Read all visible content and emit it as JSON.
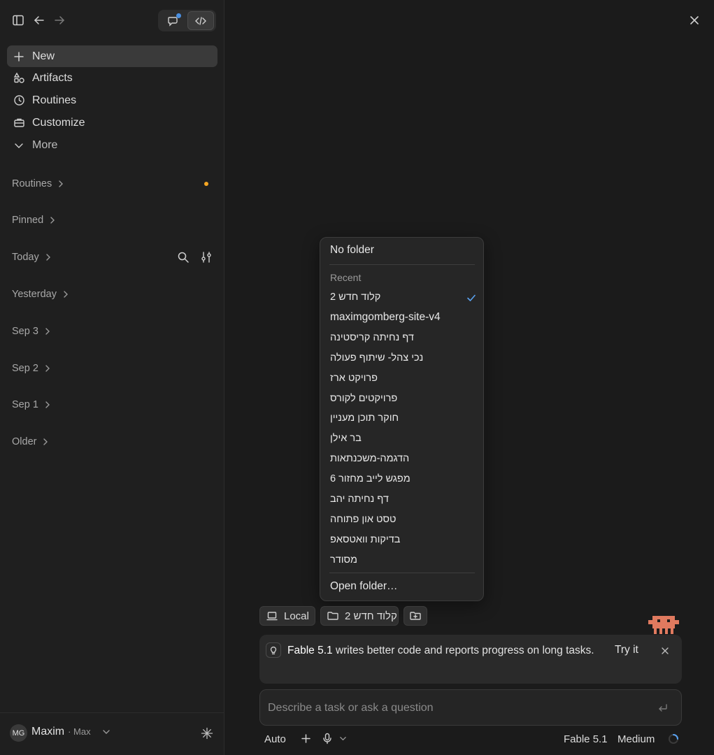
{
  "sidebar": {
    "nav": [
      {
        "label": "New",
        "icon": "plus-icon"
      },
      {
        "label": "Artifacts",
        "icon": "shapes-icon"
      },
      {
        "label": "Routines",
        "icon": "clock-icon"
      },
      {
        "label": "Customize",
        "icon": "briefcase-icon"
      },
      {
        "label": "More",
        "icon": "chevron-down-icon"
      }
    ],
    "sections": [
      {
        "label": "Routines"
      },
      {
        "label": "Pinned"
      },
      {
        "label": "Today"
      },
      {
        "label": "Yesterday"
      },
      {
        "label": "Sep 3"
      },
      {
        "label": "Sep 2"
      },
      {
        "label": "Sep 1"
      },
      {
        "label": "Older"
      }
    ],
    "notification_dot_color": "#f5a623",
    "user": {
      "initials": "MG",
      "name": "Maxim",
      "plan": "· Max"
    }
  },
  "folder_menu": {
    "no_folder": "No folder",
    "recent_label": "Recent",
    "recent": [
      "קלוד חדש 2",
      "maximgomberg-site-v4",
      "דף נחיתה קריסטינה",
      "נכי צהל- שיתוף פעולה",
      "פרויקט ארז",
      "פרויקטים לקורס",
      "חוקר תוכן מעניין",
      "בר אילן",
      "הדגמה-משכנתאות",
      "מפגש לייב מחזור 6",
      "דף נחיתה יהב",
      "טסט און פתוחה",
      "בדיקות וואטסאפ",
      "מסודר"
    ],
    "selected_index": 0,
    "open_folder": "Open folder…"
  },
  "chips": {
    "local": "Local",
    "folder": "קלוד חדש 2"
  },
  "banner": {
    "model": "Fable 5.1",
    "text": "writes better code and reports progress on long tasks.",
    "try_label": "Try it"
  },
  "composer": {
    "placeholder": "Describe a task or ask a question"
  },
  "bottom": {
    "mode": "Auto",
    "model": "Fable 5.1",
    "effort": "Medium"
  },
  "colors": {
    "accent_blue": "#5aa2f0",
    "mascot": "#e07a5f"
  }
}
